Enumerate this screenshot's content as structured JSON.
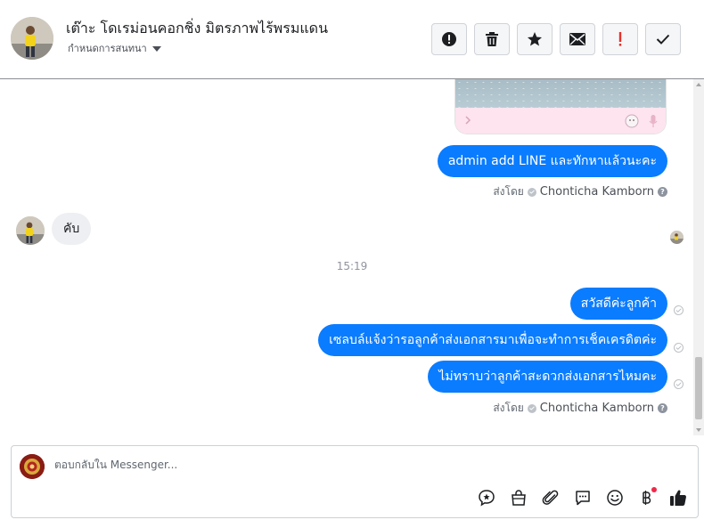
{
  "header": {
    "title": "เต๊าะ โดเรม่อนคอกชิ่ง มิตรภาพไร้พรมแดน",
    "subtitle": "กำหนดการสนทนา",
    "toolbar": [
      {
        "name": "spam-button",
        "icon": "alert-circle-icon"
      },
      {
        "name": "delete-button",
        "icon": "trash-icon"
      },
      {
        "name": "star-button",
        "icon": "star-icon"
      },
      {
        "name": "mark-unread-button",
        "icon": "envelope-icon"
      },
      {
        "name": "follow-up-button",
        "icon": "exclamation-icon"
      },
      {
        "name": "mark-done-button",
        "icon": "checkmark-icon"
      }
    ]
  },
  "messages": {
    "outgoing_1": "admin add LINE และทักหาแล้วนะคะ",
    "sent_by_label": "ส่งโดย",
    "sent_by_name": "Chonticha Kamborn",
    "incoming_1": "คับ",
    "timestamp": "15:19",
    "outgoing_2": "สวัสดีค่ะลูกค้า",
    "outgoing_3": "เซลบล์แจ้งว่ารอลูกค้าส่งเอกสารมาเพื่อจะทำการเช็คเครดิตค่ะ",
    "outgoing_4": "ไม่ทราบว่าลูกค้าสะดวกส่งเอกสารไหมคะ"
  },
  "composer": {
    "placeholder": "ตอบกลับใน Messenger..."
  },
  "colors": {
    "outgoing_bubble": "#0a7cff",
    "incoming_bubble": "#eeeff2",
    "notification_dot": "#f02849"
  }
}
